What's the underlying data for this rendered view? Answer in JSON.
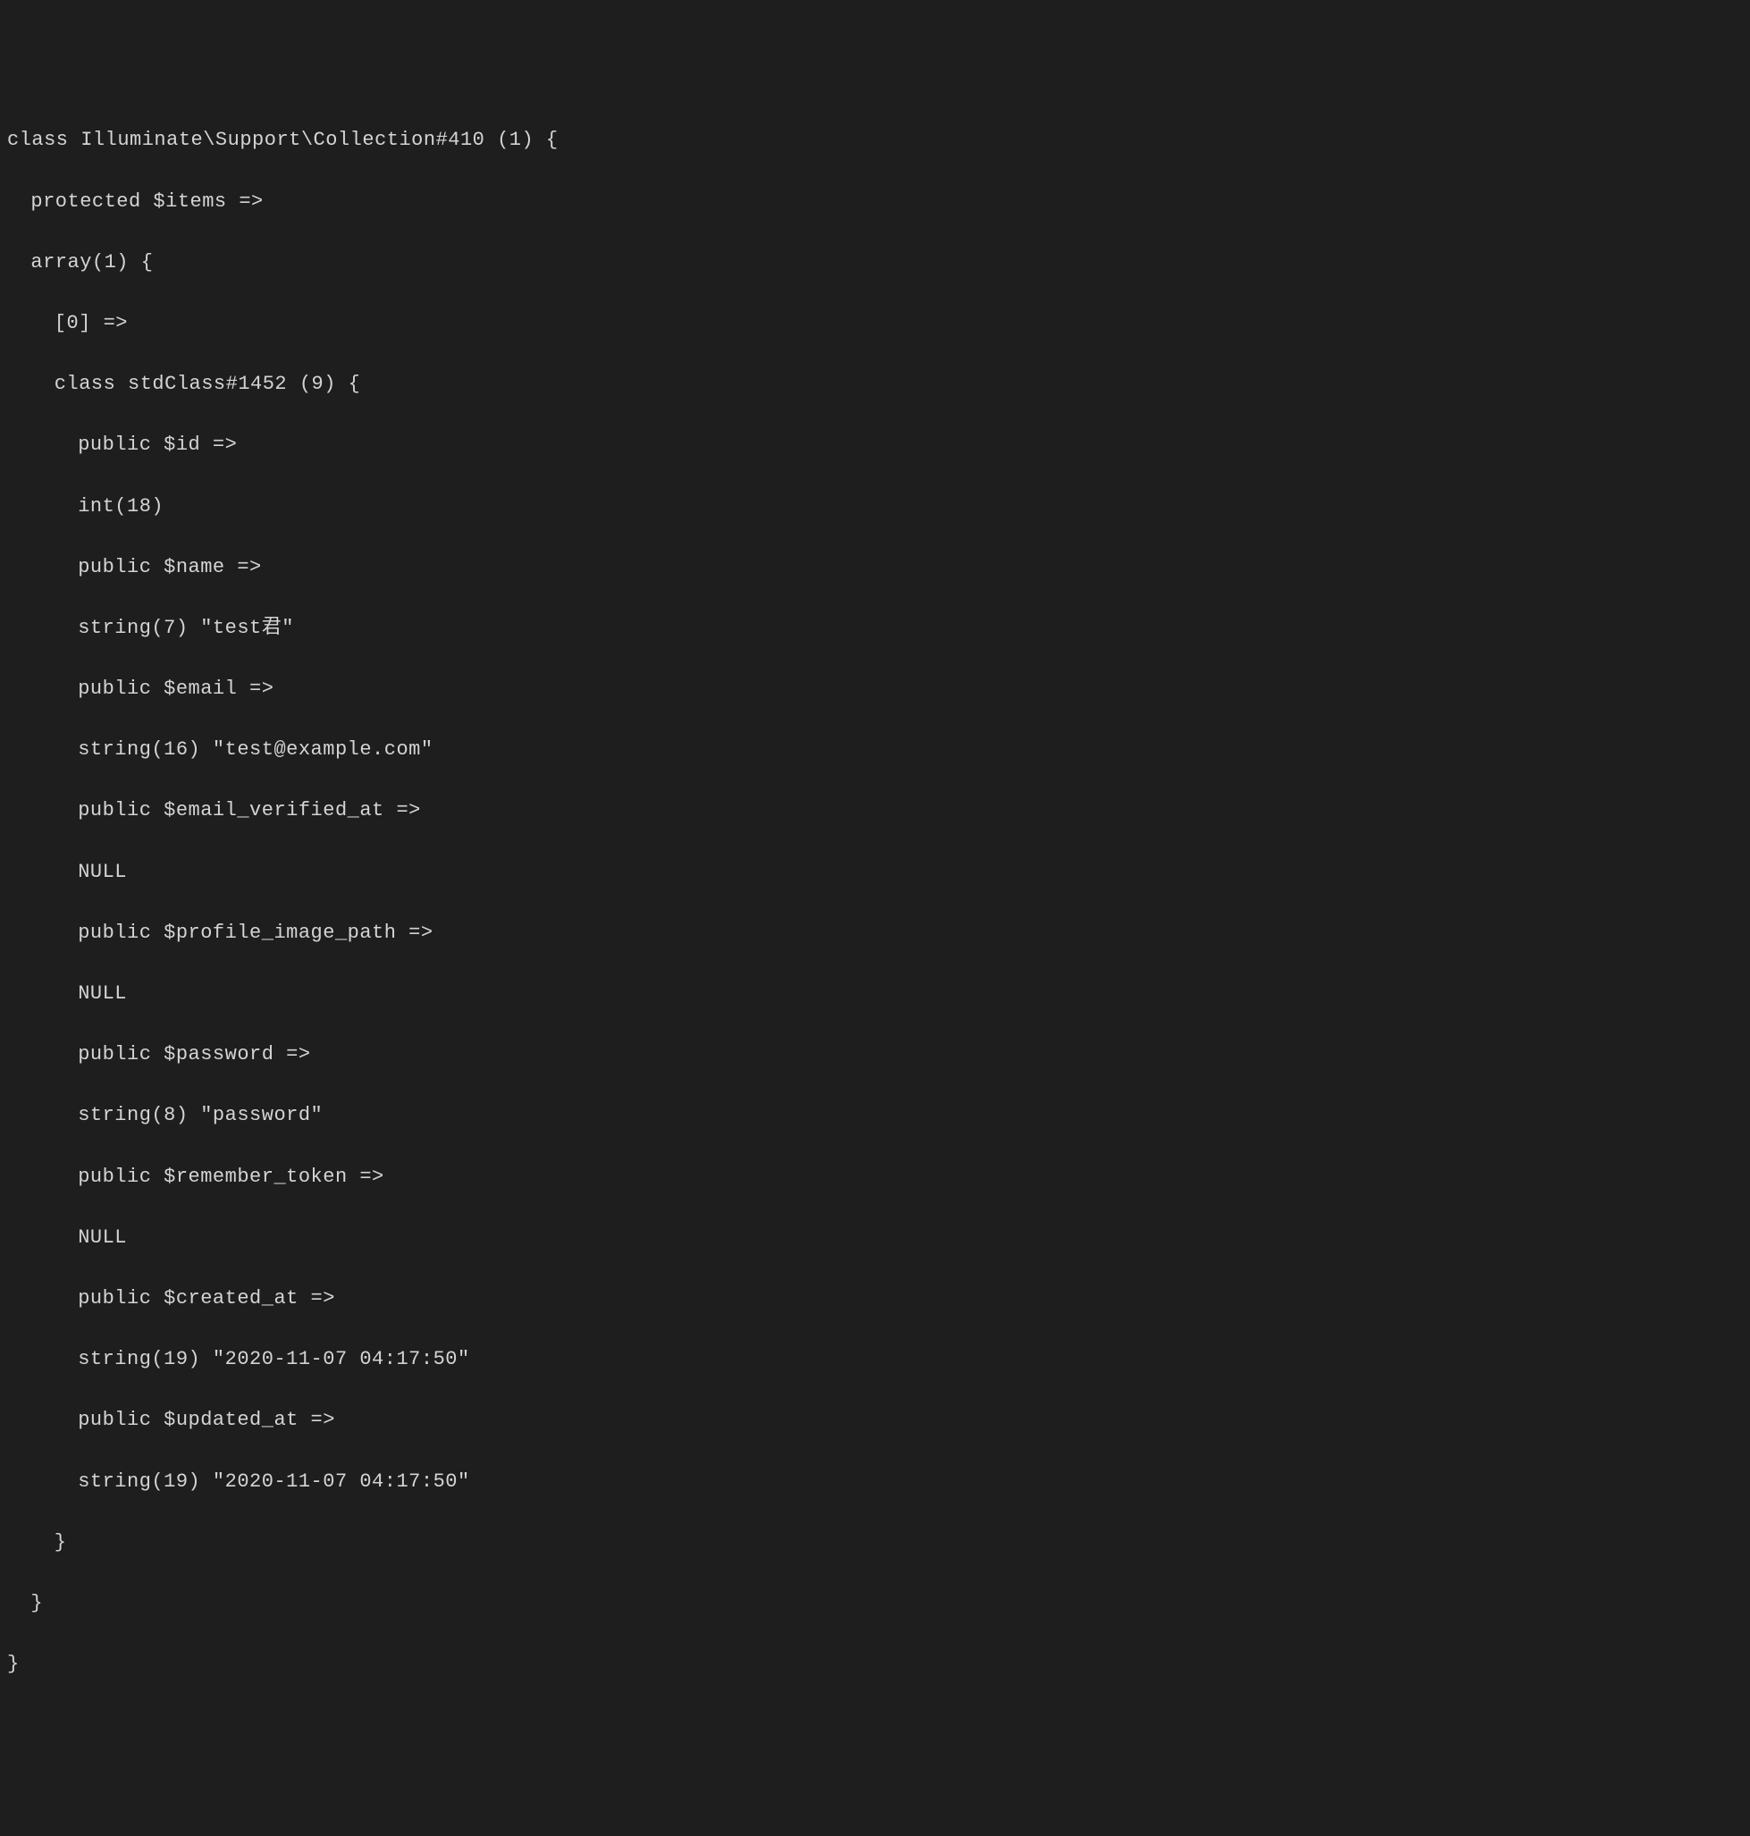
{
  "dump": {
    "l01": "class Illuminate\\Support\\Collection#410 (1) {",
    "l02": "protected $items =>",
    "l03": "array(1) {",
    "l04": "[0] =>",
    "l05": "class stdClass#1452 (9) {",
    "l06": "public $id =>",
    "l07": "int(18)",
    "l08": "public $name =>",
    "l09": "string(7) \"test君\"",
    "l10": "public $email =>",
    "l11": "string(16) \"test@example.com\"",
    "l12": "public $email_verified_at =>",
    "l13": "NULL",
    "l14": "public $profile_image_path =>",
    "l15": "NULL",
    "l16": "public $password =>",
    "l17": "string(8) \"password\"",
    "l18": "public $remember_token =>",
    "l19": "NULL",
    "l20": "public $created_at =>",
    "l21": "string(19) \"2020-11-07 04:17:50\"",
    "l22": "public $updated_at =>",
    "l23": "string(19) \"2020-11-07 04:17:50\"",
    "l24": "}",
    "l25": "}",
    "l26": "}"
  }
}
